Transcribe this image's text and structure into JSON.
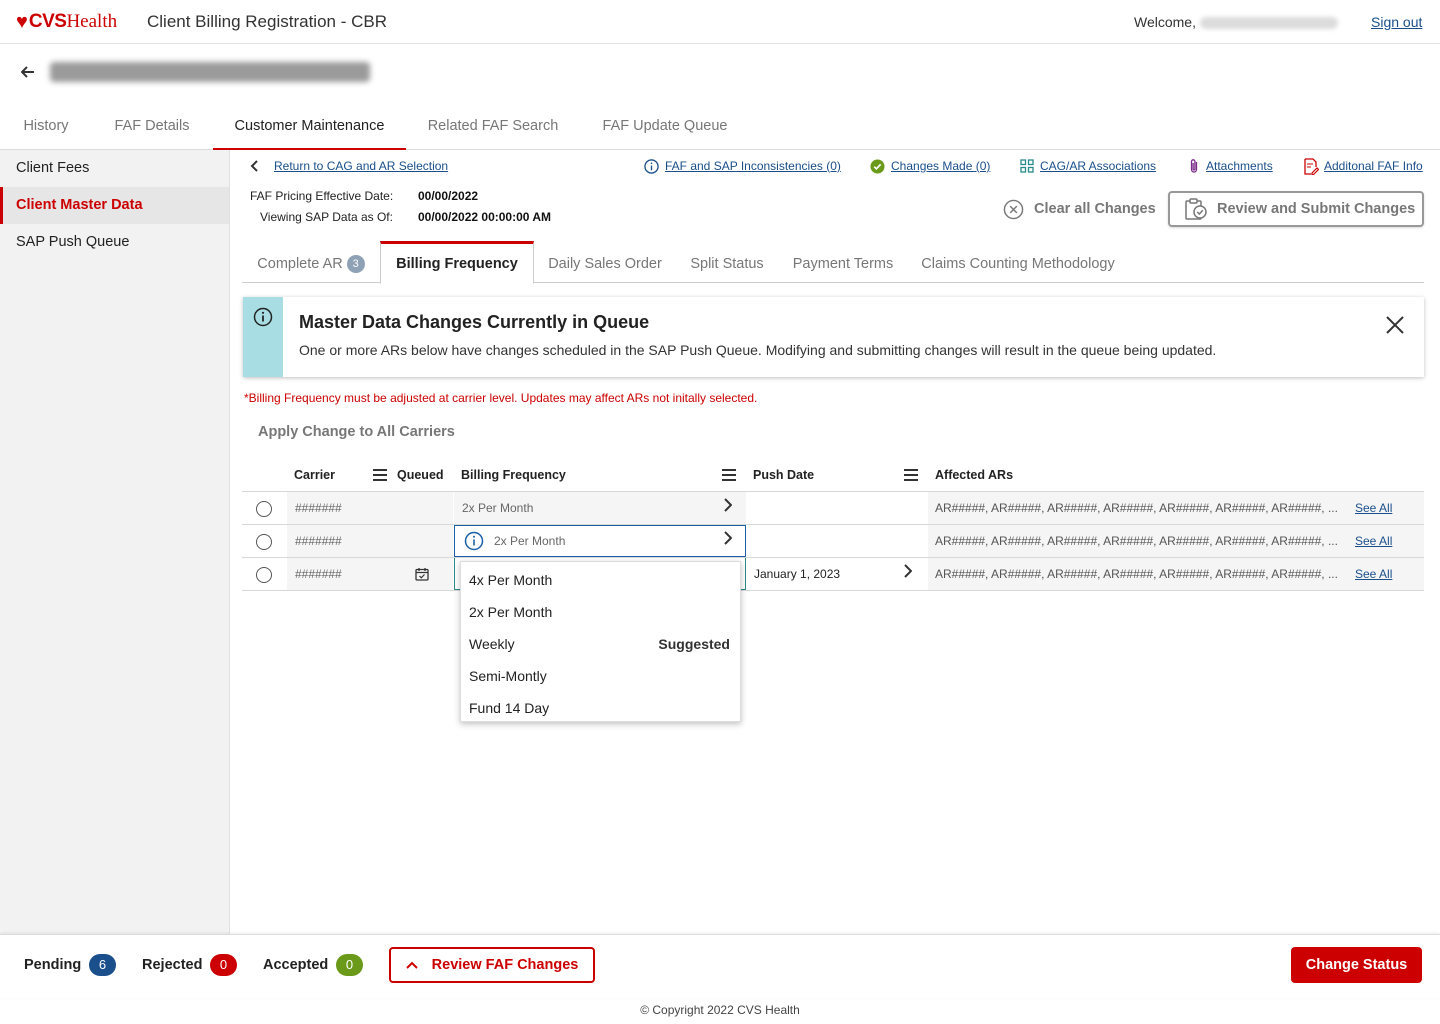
{
  "header": {
    "brand_cvs": "CVS",
    "brand_health": "Health",
    "app_title": "Client Billing Registration - CBR",
    "welcome": "Welcome,",
    "sign_out": "Sign out"
  },
  "main_tabs": [
    "History",
    "FAF Details",
    "Customer Maintenance",
    "Related FAF Search",
    "FAF Update Queue"
  ],
  "sidebar": [
    "Client Fees",
    "Client Master Data",
    "SAP Push Queue"
  ],
  "links": {
    "return": "Return to CAG and AR Selection",
    "inconsistencies": "FAF and SAP Inconsistencies (0)",
    "changes_made": "Changes Made (0)",
    "associations": "CAG/AR Associations",
    "attachments": "Attachments",
    "additional": "Additonal FAF Info"
  },
  "info": {
    "pricing_label": "FAF Pricing Effective Date:",
    "pricing_value": "00/00/2022",
    "viewing_label": "Viewing SAP Data as Of:",
    "viewing_value": "00/00/2022 00:00:00 AM"
  },
  "actions": {
    "clear": "Clear all Changes",
    "review_submit": "Review and Submit Changes"
  },
  "sub_tabs": {
    "complete_ar": "Complete AR",
    "complete_ar_count": "3",
    "billing_frequency": "Billing Frequency",
    "daily_sales_order": "Daily Sales Order",
    "split_status": "Split Status",
    "payment_terms": "Payment Terms",
    "claims_counting": "Claims Counting Methodology"
  },
  "alert": {
    "title": "Master Data Changes Currently in Queue",
    "body": "One or more ARs below have changes scheduled in the SAP Push Queue. Modifying and submitting changes will result in the queue being updated."
  },
  "warning": "*Billing Frequency must be adjusted at carrier level. Updates may affect ARs not initally selected.",
  "apply_all": "Apply Change to All Carriers",
  "table": {
    "headers": {
      "carrier": "Carrier",
      "queued": "Queued",
      "billing_frequency": "Billing Frequency",
      "push_date": "Push Date",
      "affected_ars": "Affected ARs"
    },
    "rows": [
      {
        "carrier": "#######",
        "billing_frequency": "2x Per Month",
        "push_date": "",
        "affected": "AR#####, AR#####, AR#####, AR#####, AR#####, AR#####, AR#####, ...",
        "see_all": "See All"
      },
      {
        "carrier": "#######",
        "billing_frequency": "2x Per Month",
        "push_date": "",
        "affected": "AR#####, AR#####, AR#####, AR#####, AR#####, AR#####, AR#####, ...",
        "see_all": "See All"
      },
      {
        "carrier": "#######",
        "billing_frequency": "",
        "push_date": "January 1, 2023",
        "affected": "AR#####, AR#####, AR#####, AR#####, AR#####, AR#####, AR#####, ...",
        "see_all": "See All"
      }
    ]
  },
  "dropdown": {
    "options": [
      "4x Per Month",
      "2x Per Month",
      "Weekly",
      "Semi-Montly",
      "Fund 14 Day"
    ],
    "suggested": "Suggested"
  },
  "footer": {
    "pending": "Pending",
    "pending_count": "6",
    "rejected": "Rejected",
    "rejected_count": "0",
    "accepted": "Accepted",
    "accepted_count": "0",
    "review_faf": "Review FAF Changes",
    "change_status": "Change Status",
    "copyright": "© Copyright 2022 CVS Health"
  },
  "colors": {
    "brand_red": "#cc0000",
    "link_blue": "#1a4f8b",
    "pending_blue": "#1a4f8b",
    "rejected_red": "#cc0000",
    "accepted_green": "#6b9a1b",
    "alert_teal": "#a7dde3"
  }
}
